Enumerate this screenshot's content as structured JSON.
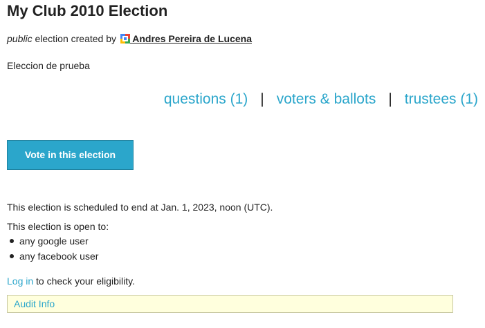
{
  "election": {
    "title": "My Club 2010 Election",
    "visibility": "public",
    "created_by_text": " election created by ",
    "creator_name": " Andres Pereira de Lucena",
    "description": "Eleccion de prueba"
  },
  "nav": {
    "questions": "questions (1)",
    "separator": "|",
    "voters_ballots": "voters & ballots",
    "trustees": "trustees (1)"
  },
  "vote_button_label": "Vote in this election",
  "schedule_text": "This election is scheduled to end at Jan. 1, 2023, noon (UTC).",
  "open_to": {
    "heading": "This election is open to:",
    "items": [
      "any google user",
      "any facebook user"
    ]
  },
  "login": {
    "link": "Log in",
    "suffix": " to check your eligibility."
  },
  "audit_info_label": "Audit Info",
  "colors": {
    "link": "#2ba6cb",
    "button_bg": "#2ba6cb",
    "audit_bg": "#ffffdd"
  },
  "icons": {
    "creator_provider": "google-logo-icon"
  }
}
